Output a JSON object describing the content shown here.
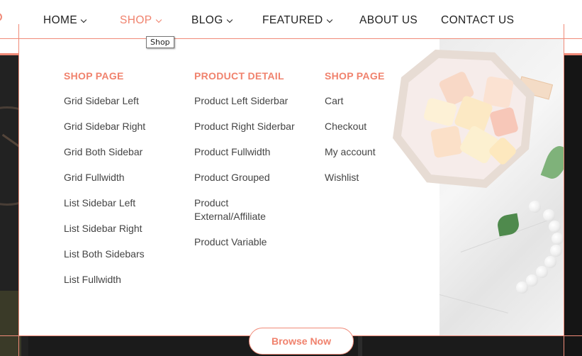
{
  "nav": {
    "items": [
      {
        "label": "HOME",
        "has_dropdown": true,
        "active": false
      },
      {
        "label": "SHOP",
        "has_dropdown": true,
        "active": true
      },
      {
        "label": "BLOG",
        "has_dropdown": true,
        "active": false
      },
      {
        "label": "FEATURED",
        "has_dropdown": true,
        "active": false
      },
      {
        "label": "ABOUT US",
        "has_dropdown": false,
        "active": false
      },
      {
        "label": "CONTACT US",
        "has_dropdown": false,
        "active": false
      }
    ],
    "tooltip": "Shop"
  },
  "mega_menu": {
    "columns": [
      {
        "title": "SHOP PAGE",
        "links": [
          "Grid Sidebar Left",
          "Grid Sidebar Right",
          "Grid Both Sidebar",
          "Grid Fullwidth",
          "List Sidebar Left",
          "List Sidebar Right",
          "List Both Sidebars",
          "List Fullwidth"
        ]
      },
      {
        "title": "PRODUCT DETAIL",
        "links": [
          "Product Left Siderbar",
          "Product Right Siderbar",
          "Product Fullwidth",
          "Product Grouped",
          "Product External/Affiliate",
          "Product Variable"
        ]
      },
      {
        "title": "SHOP PAGE",
        "links": [
          "Cart",
          "Checkout",
          "My account",
          "Wishlist"
        ]
      }
    ]
  },
  "hero": {
    "button_label": "Browse Now"
  },
  "colors": {
    "accent": "#f0826d",
    "text": "#444444",
    "nav_text": "#222222"
  }
}
